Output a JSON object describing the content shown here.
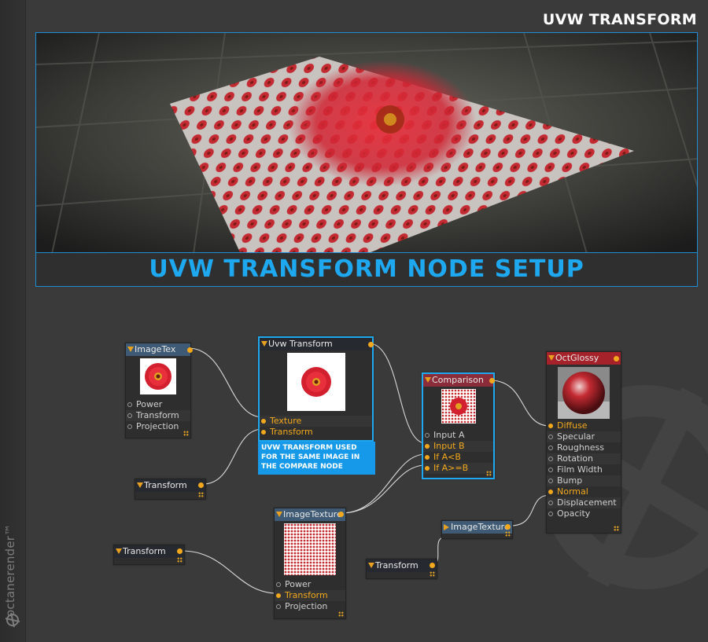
{
  "page": {
    "title": "UVW TRANSFORM",
    "banner": "UVW TRANSFORM NODE SETUP",
    "brand": "octanerender™"
  },
  "colors": {
    "accent_blue": "#1ea8f0",
    "pin_active": "#f2a81c",
    "node_bg": "#2e2e2e",
    "background": "#3a3a3a"
  },
  "nodes": {
    "imagetex": {
      "title": "ImageTex",
      "pins": [
        "Power",
        "Transform",
        "Projection"
      ]
    },
    "uvw_transform": {
      "title": "Uvw Transform",
      "pins": [
        "Texture",
        "Transform"
      ]
    },
    "note": "UVW TRANSFORM USED FOR THE SAME IMAGE IN THE COMPARE NODE",
    "transform_1": {
      "title": "Transform"
    },
    "comparison": {
      "title": "Comparison",
      "pins": [
        "Input A",
        "Input B",
        "If A<B",
        "If A>=B"
      ]
    },
    "octglossy": {
      "title": "OctGlossy",
      "pins": [
        "Diffuse",
        "Specular",
        "Roughness",
        "Rotation",
        "Film Width",
        "Bump",
        "Normal",
        "Displacement",
        "Opacity"
      ]
    },
    "imagetexture_main": {
      "title": "ImageTexture",
      "pins": [
        "Power",
        "Transform",
        "Projection"
      ]
    },
    "imagetexture_small": {
      "title": "ImageTexture"
    },
    "transform_2": {
      "title": "Transform"
    },
    "transform_3": {
      "title": "Transform"
    }
  },
  "icons": [
    "flower-thumbnail",
    "octane-logo-icon",
    "node-grip-icon"
  ]
}
